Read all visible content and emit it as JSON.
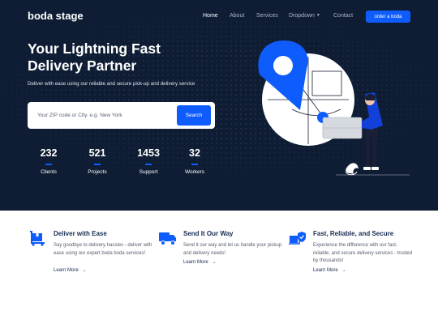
{
  "brand": "boda stage",
  "nav": {
    "items": [
      "Home",
      "About",
      "Services",
      "Dropdown",
      "Contact"
    ],
    "dropdown_caret": "▼",
    "cta": "order a boda"
  },
  "hero": {
    "title": "Your Lightning Fast Delivery Partner",
    "subtitle": "Deliver with ease using our reliable and secure pick-up and delivery service",
    "search_placeholder": "Your ZIP code or City. e.g. New York",
    "search_button": "Search"
  },
  "stats": [
    {
      "value": "232",
      "label": "Clients"
    },
    {
      "value": "521",
      "label": "Projects"
    },
    {
      "value": "1453",
      "label": "Support"
    },
    {
      "value": "32",
      "label": "Workers"
    }
  ],
  "features": [
    {
      "icon": "dolly-icon",
      "title": "Deliver with Ease",
      "description": "Say goodbye to delivery hassles - deliver with ease using our expert boda boda services!",
      "link": "Learn More",
      "arrow": "→"
    },
    {
      "icon": "truck-icon",
      "title": "Send It Our Way",
      "description": "Send it our way and let us handle your pickup and delivery needs!",
      "link": "Learn More",
      "arrow": "→"
    },
    {
      "icon": "secure-delivery-icon",
      "title": "Fast, Reliable, and Secure",
      "description": "Experience the difference with our fast, reliable, and secure delivery services - trusted by thousands!",
      "link": "Learn More",
      "arrow": "→"
    }
  ],
  "colors": {
    "hero_bg": "#0e1d34",
    "accent": "#0e5cfb",
    "feature_title": "#152b52"
  }
}
